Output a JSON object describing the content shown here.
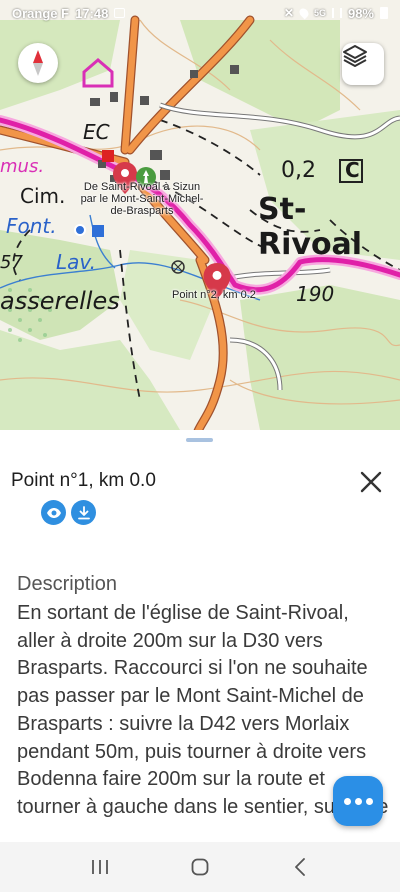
{
  "status_bar": {
    "carrier": "Orange F",
    "time": "17:48",
    "network": "5G",
    "battery": "98%"
  },
  "map": {
    "labels": {
      "route_name": "De Saint-Rivoal à Sizun par le Mont-Saint-Michel-de-Brasparts",
      "point_1": "Point n°1, km 0.0",
      "point_2": "Point n°2, km 0.2"
    },
    "place_names": {
      "st_rivoal": "St-Rivoal",
      "cim": "Cim.",
      "font": "Font.",
      "lav": "Lav.",
      "passerelles": "asserelles",
      "mus": "mus.",
      "ec": "EC",
      "height_190": "190",
      "distance": "0,2",
      "c_marker": "C",
      "num_57": "57"
    },
    "colors": {
      "route": "#e020a8",
      "road": "#f08a3c",
      "forest": "#cfe6b4",
      "marker": "#d6394a"
    }
  },
  "sheet": {
    "title": "Point n°1, km 0.0",
    "description_label": "Description",
    "description": "En sortant de l'église de Saint-Rivoal, aller à droite 200m sur la D30 vers Brasparts. Raccourci si l'on ne souhaite pas passer par le Mont Saint-Michel de Brasparts : suivre la D42 vers Morlaix pendant 50m, puis tourner à droite vers Bodenna faire 200m sur la route et tourner à gauche dans le sentier, suivre le"
  },
  "icons": {
    "compass": "compass-icon",
    "layers": "layers-icon",
    "close": "close-icon",
    "eye": "eye-icon",
    "download": "download-icon",
    "more": "more-icon"
  }
}
